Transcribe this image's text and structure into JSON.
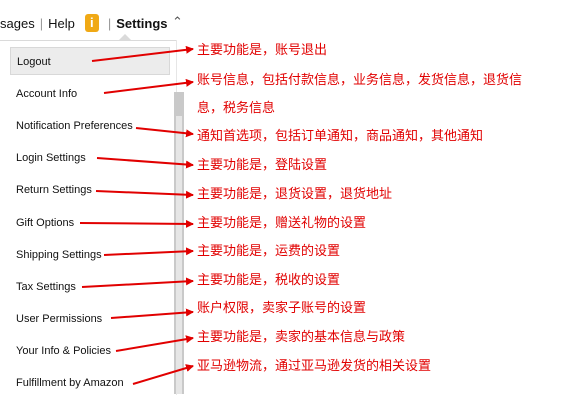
{
  "nav": {
    "messages_label": "sages",
    "help_label": "Help",
    "info_label": "i",
    "settings_label": "Settings"
  },
  "menu": {
    "items": [
      {
        "label": "Logout"
      },
      {
        "label": "Account Info"
      },
      {
        "label": "Notification Preferences"
      },
      {
        "label": "Login Settings"
      },
      {
        "label": "Return Settings"
      },
      {
        "label": "Gift Options"
      },
      {
        "label": "Shipping Settings"
      },
      {
        "label": "Tax Settings"
      },
      {
        "label": "User Permissions"
      },
      {
        "label": "Your Info & Policies"
      },
      {
        "label": "Fulfillment by Amazon"
      }
    ]
  },
  "annotations": [
    "主要功能是，账号退出",
    "账号信息，包括付款信息，业务信息，发货信息，退货信",
    "息，税务信息",
    "通知首选项，包括订单通知，商品通知，其他通知",
    "主要功能是，登陆设置",
    "主要功能是，退货设置，退货地址",
    "主要功能是，赠送礼物的设置",
    "主要功能是，运费的设置",
    "主要功能是，税收的设置",
    "账户权限，卖家子账号的设置",
    "主要功能是，卖家的基本信息与政策",
    "亚马逊物流，通过亚马逊发货的相关设置"
  ],
  "colors": {
    "annotation": "#e10000",
    "info_badge": "#f0a915"
  }
}
